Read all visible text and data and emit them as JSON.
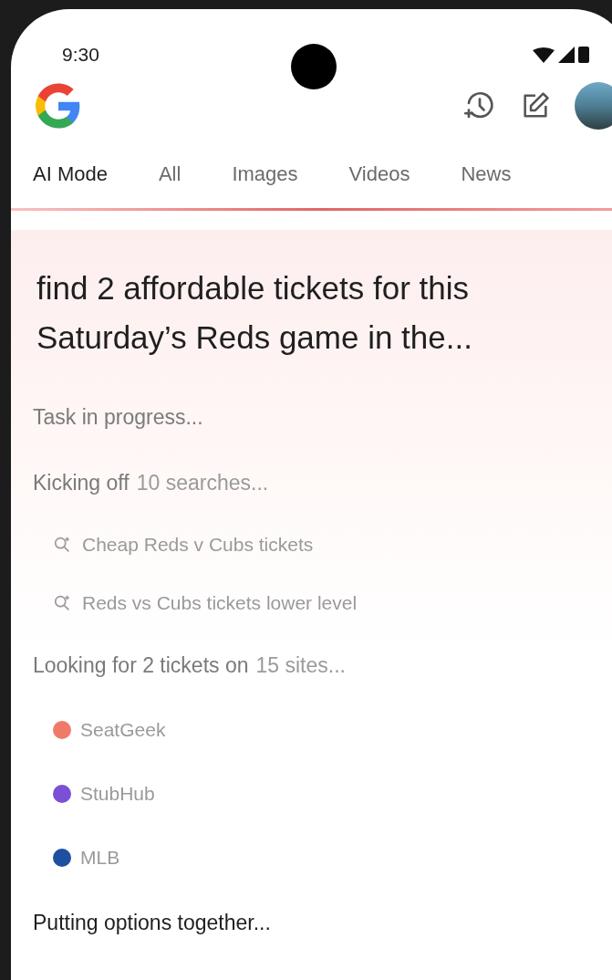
{
  "status_bar": {
    "time": "9:30"
  },
  "tabs": [
    {
      "label": "AI Mode",
      "selected": true
    },
    {
      "label": "All",
      "selected": false
    },
    {
      "label": "Images",
      "selected": false
    },
    {
      "label": "Videos",
      "selected": false
    },
    {
      "label": "News",
      "selected": false
    }
  ],
  "query": "find 2 affordable tickets for this Saturday’s Reds game in the...",
  "steps": [
    {
      "kind": "status",
      "text": "Task in progress...",
      "active": false
    },
    {
      "kind": "group",
      "label": "Kicking off",
      "detail": "10 searches...",
      "active": false,
      "items": [
        {
          "kind": "search",
          "text": "Cheap Reds v Cubs tickets"
        },
        {
          "kind": "search",
          "text": "Reds vs Cubs tickets lower level"
        }
      ]
    },
    {
      "kind": "group",
      "label": "Looking for 2 tickets on",
      "detail": "15 sites...",
      "active": false,
      "items": [
        {
          "kind": "site",
          "text": "SeatGeek",
          "color": "#f07a68"
        },
        {
          "kind": "site",
          "text": "StubHub",
          "color": "#7b4fd6"
        },
        {
          "kind": "site",
          "text": "MLB",
          "color": "#1f4fa0"
        }
      ]
    },
    {
      "kind": "status",
      "text": "Putting options together...",
      "active": true
    }
  ]
}
